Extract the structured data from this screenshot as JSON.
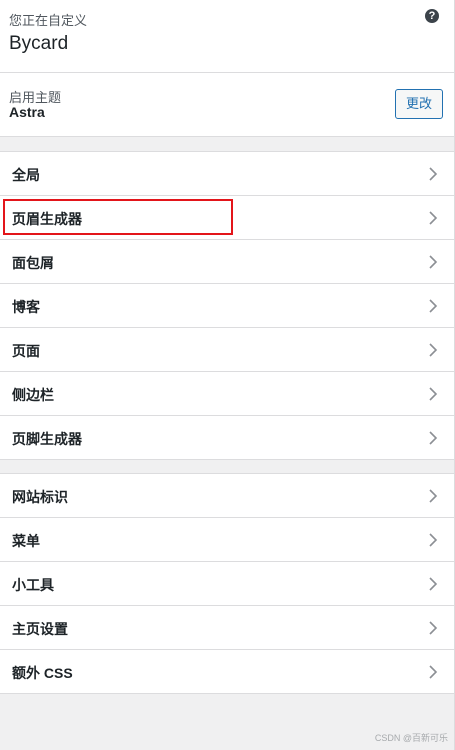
{
  "header": {
    "pre_title": "您正在自定义",
    "title": "Bycard",
    "help_icon": "?"
  },
  "theme": {
    "label": "启用主题",
    "name": "Astra",
    "change_button": "更改"
  },
  "menu_groups": [
    {
      "items": [
        {
          "label": "全局"
        },
        {
          "label": "页眉生成器",
          "highlighted": true
        },
        {
          "label": "面包屑"
        },
        {
          "label": "博客"
        },
        {
          "label": "页面"
        },
        {
          "label": "侧边栏"
        },
        {
          "label": "页脚生成器"
        }
      ]
    },
    {
      "items": [
        {
          "label": "网站标识"
        },
        {
          "label": "菜单"
        },
        {
          "label": "小工具"
        },
        {
          "label": "主页设置"
        },
        {
          "label": "额外 CSS"
        }
      ]
    }
  ],
  "icons": {
    "chevron": "chevron-right-icon",
    "help": "question-circle-icon"
  },
  "colors": {
    "accent": "#2271b1",
    "highlight": "#e3151a",
    "background": "#f0f0f1"
  },
  "watermark": "CSDN @百新可乐"
}
